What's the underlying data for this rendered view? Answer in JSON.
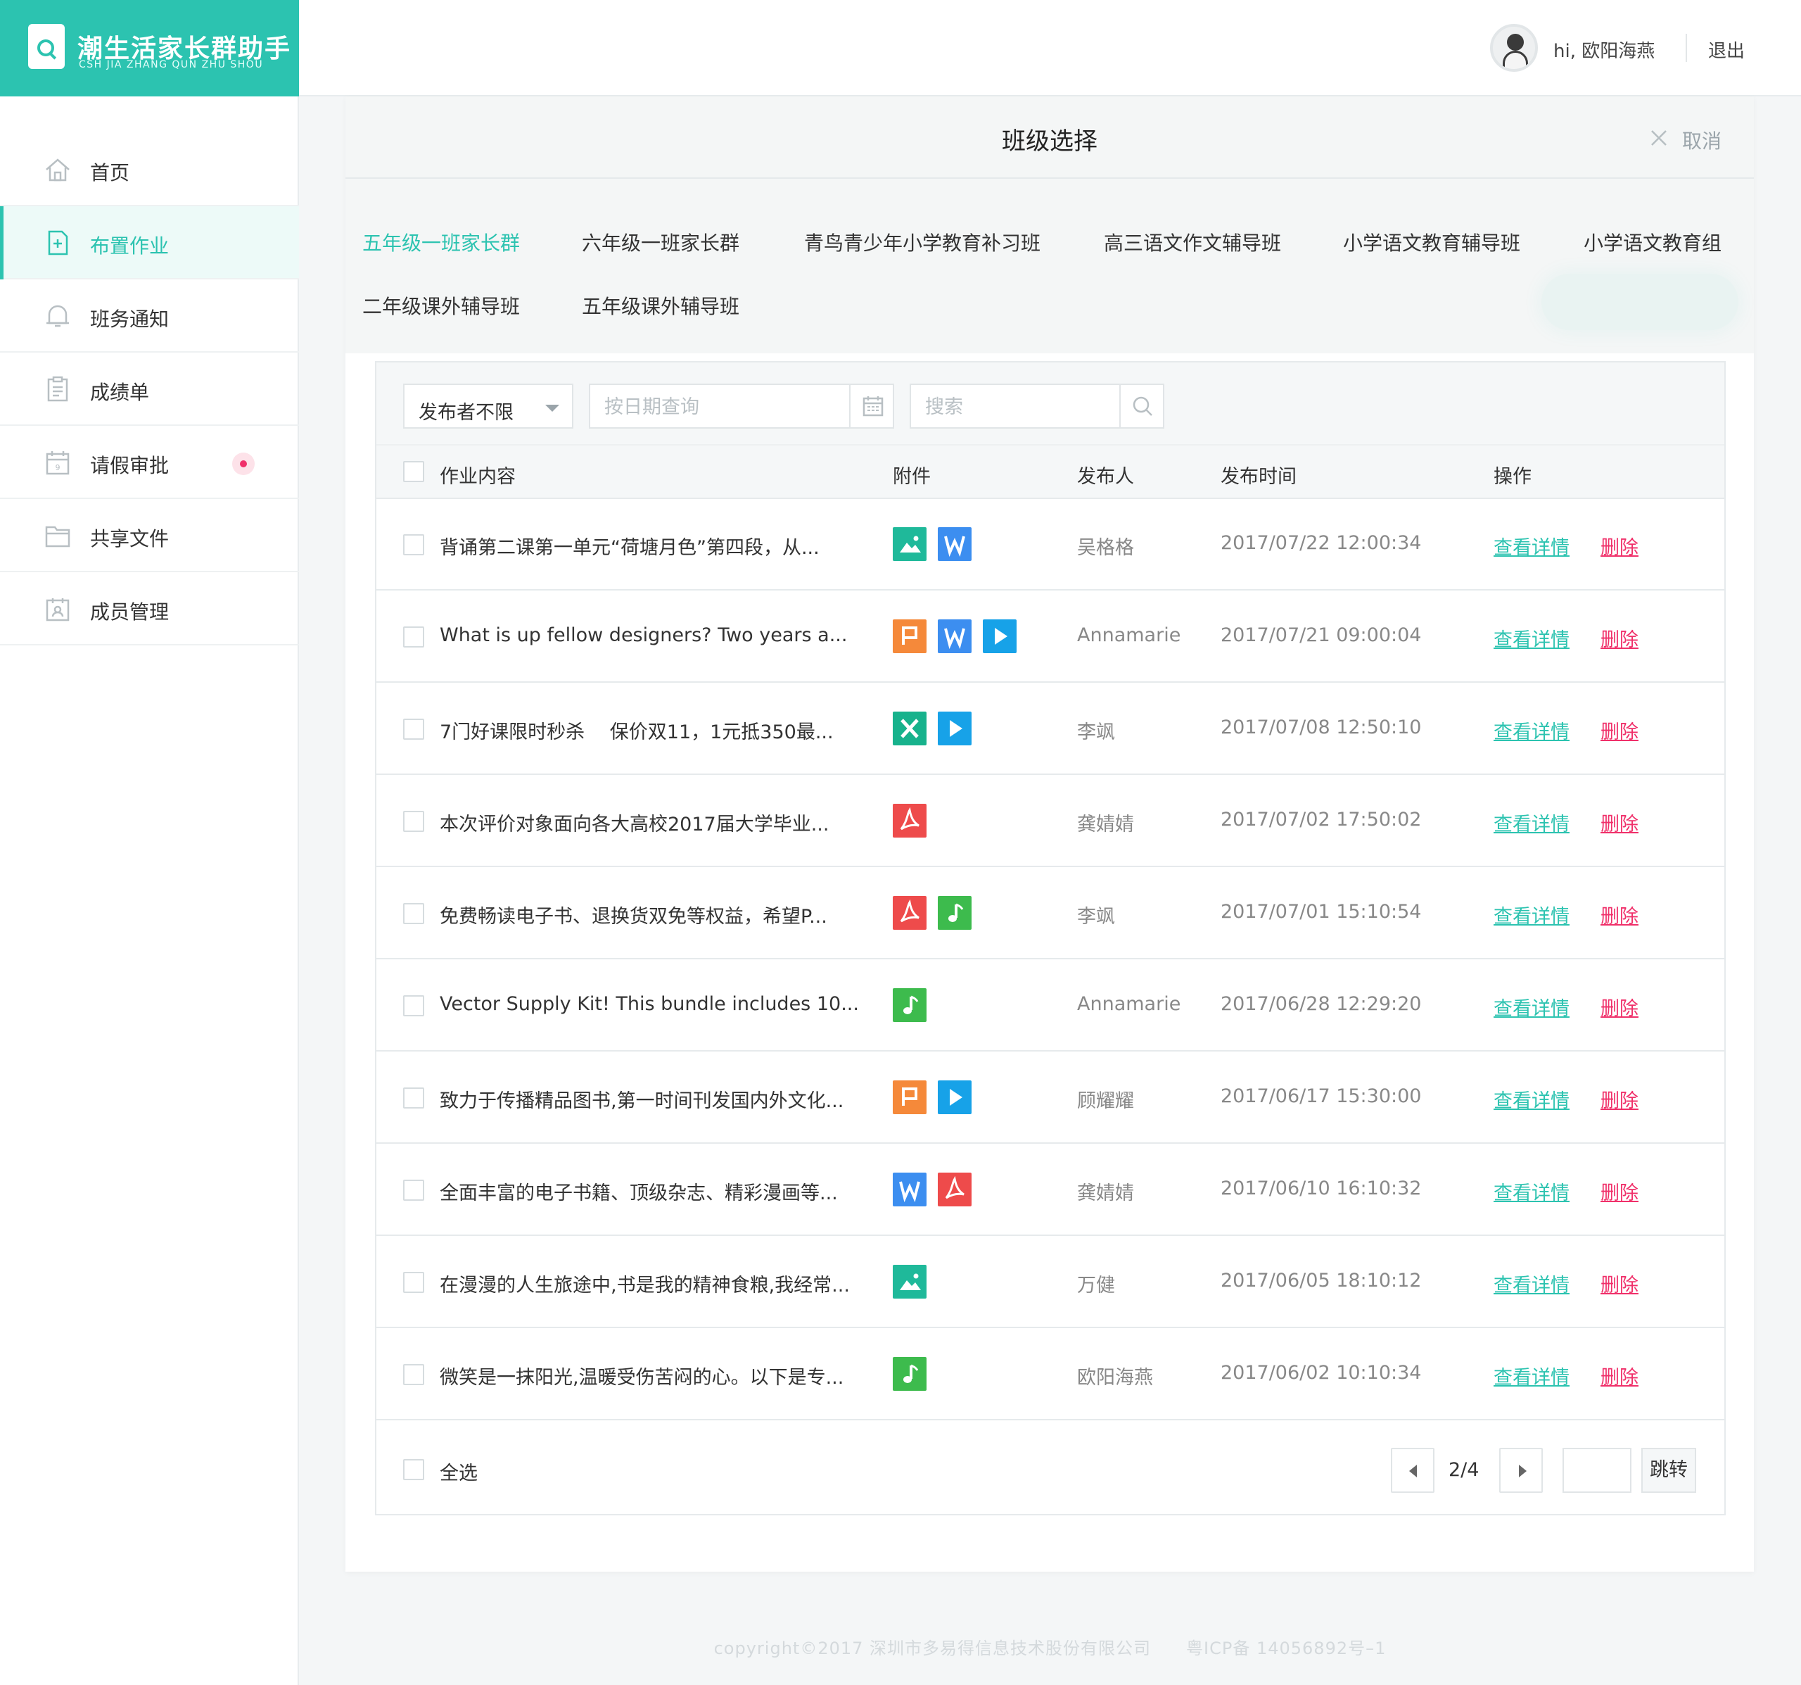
{
  "brand": {
    "title": "潮生活家长群助手",
    "subtitle": "CSH JIA ZHANG QUN ZHU SHOU"
  },
  "header": {
    "greeting": "hi, 欧阳海燕",
    "logout": "退出"
  },
  "sidebar": {
    "items": [
      {
        "label": "首页",
        "icon": "home-icon"
      },
      {
        "label": "布置作业",
        "icon": "assignment-icon",
        "active": true
      },
      {
        "label": "班务通知",
        "icon": "bell-icon"
      },
      {
        "label": "成绩单",
        "icon": "clipboard-icon"
      },
      {
        "label": "请假审批",
        "icon": "calendar-icon",
        "badge": true
      },
      {
        "label": "共享文件",
        "icon": "folder-icon"
      },
      {
        "label": "成员管理",
        "icon": "members-icon"
      }
    ]
  },
  "panel": {
    "title": "班级选择",
    "cancel": "取消",
    "classes": [
      "五年级一班家长群",
      "六年级一班家长群",
      "青鸟青少年小学教育补习班",
      "高三语文作文辅导班",
      "小学语文教育辅导班",
      "小学语文教育组",
      "二年级课外辅导班",
      "五年级课外辅导班"
    ],
    "active_class": "五年级一班家长群"
  },
  "filters": {
    "publisher": "发布者不限",
    "date_placeholder": "按日期查询",
    "search_placeholder": "搜索"
  },
  "table": {
    "headers": [
      "作业内容",
      "附件",
      "发布人",
      "发布时间",
      "操作"
    ],
    "rows": [
      {
        "title": "背诵第二课第一单元“荷塘月色”第四段，从...",
        "attachments": [
          "image",
          "word"
        ],
        "publisher": "吴格格",
        "time": "2017/07/22 12:00:34",
        "view": "查看详情",
        "delete": "删除"
      },
      {
        "title": "What is up fellow designers? Two years a...",
        "attachments": [
          "ppt",
          "word",
          "video"
        ],
        "publisher": "Annamarie",
        "time": "2017/07/21 09:00:04",
        "view": "查看详情",
        "delete": "删除"
      },
      {
        "title": "7门好课限时秒杀　 保价双11，1元抵350最...",
        "attachments": [
          "excel",
          "video"
        ],
        "publisher": "李飒",
        "time": "2017/07/08 12:50:10",
        "view": "查看详情",
        "delete": "删除"
      },
      {
        "title": "本次评价对象面向各大高校2017届大学毕业...",
        "attachments": [
          "pdf"
        ],
        "publisher": "龚婧婧",
        "time": "2017/07/02 17:50:02",
        "view": "查看详情",
        "delete": "删除"
      },
      {
        "title": "免费畅读电子书、退换货双免等权益，希望P...",
        "attachments": [
          "pdf",
          "music"
        ],
        "publisher": "李飒",
        "time": "2017/07/01 15:10:54",
        "view": "查看详情",
        "delete": "删除"
      },
      {
        "title": "Vector Supply Kit! This bundle includes 10...",
        "attachments": [
          "music"
        ],
        "publisher": "Annamarie",
        "time": "2017/06/28 12:29:20",
        "view": "查看详情",
        "delete": "删除"
      },
      {
        "title": "致力于传播精品图书,第一时间刊发国内外文化...",
        "attachments": [
          "ppt",
          "video"
        ],
        "publisher": "顾耀耀",
        "time": "2017/06/17 15:30:00",
        "view": "查看详情",
        "delete": "删除"
      },
      {
        "title": "全面丰富的电子书籍、顶级杂志、精彩漫画等...",
        "attachments": [
          "word",
          "pdf"
        ],
        "publisher": "龚婧婧",
        "time": "2017/06/10 16:10:32",
        "view": "查看详情",
        "delete": "删除"
      },
      {
        "title": "在漫漫的人生旅途中,书是我的精神食粮,我经常...",
        "attachments": [
          "image"
        ],
        "publisher": "万健",
        "time": "2017/06/05 18:10:12",
        "view": "查看详情",
        "delete": "删除"
      },
      {
        "title": "微笑是一抹阳光,温暖受伤苦闷的心。以下是专...",
        "attachments": [
          "music"
        ],
        "publisher": "欧阳海燕",
        "time": "2017/06/02 10:10:34",
        "view": "查看详情",
        "delete": "删除"
      }
    ]
  },
  "footer": {
    "select_all": "全选",
    "page_info": "2/4",
    "jump": "跳转"
  },
  "copyright": "copyright©2017 深圳市多易得信息技术股份有限公司　　粤ICP备 14056892号–1",
  "colors": {
    "accent": "#2cc3b0",
    "danger": "#f0306a",
    "image": "#1fb99a",
    "word": "#3c8ef0",
    "ppt": "#f5893a",
    "video": "#17a2e8",
    "excel": "#17b28c",
    "pdf": "#ee4b4b",
    "music": "#3dbb4d"
  }
}
